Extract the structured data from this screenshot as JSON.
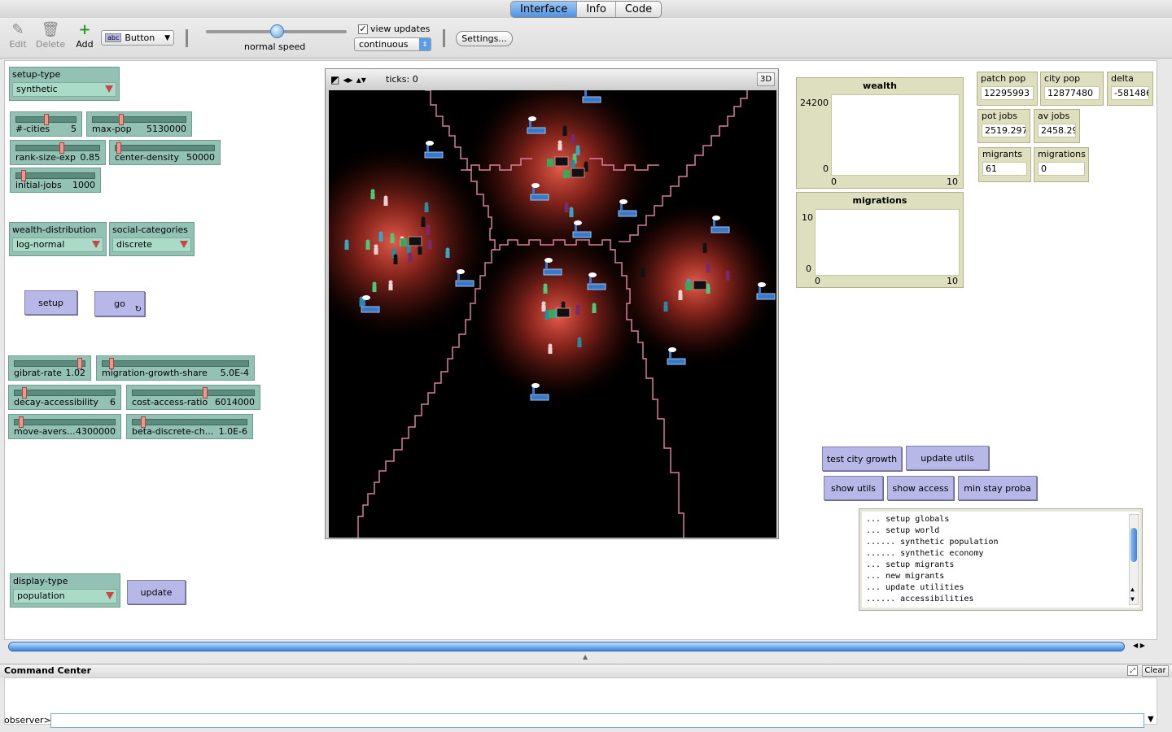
{
  "tabs": [
    "Interface",
    "Info",
    "Code"
  ],
  "toolbar": {
    "edit": "Edit",
    "delete": "Delete",
    "add": "Add",
    "widget_type": "Button",
    "speed_label": "normal speed",
    "speed_level": 0.5,
    "view_updates_label": "view updates",
    "view_updates_checked": true,
    "update_mode": "continuous",
    "settings": "Settings..."
  },
  "choosers": {
    "setup_type": {
      "label": "setup-type",
      "value": "synthetic"
    },
    "wealth_distribution": {
      "label": "wealth-distribution",
      "value": "log-normal"
    },
    "social_categories": {
      "label": "social-categories",
      "value": "discrete"
    },
    "display_type": {
      "label": "display-type",
      "value": "population"
    }
  },
  "sliders": {
    "n_cities": {
      "label": "#-cities",
      "value": "5",
      "level": 0.5
    },
    "max_pop": {
      "label": "max-pop",
      "value": "5130000",
      "level": 0.3
    },
    "rank_size_exp": {
      "label": "rank-size-exp",
      "value": "0.85",
      "level": 0.55
    },
    "center_density": {
      "label": "center-density",
      "value": "50000",
      "level": 0.02
    },
    "initial_jobs": {
      "label": "initial-jobs",
      "value": "1000",
      "level": 0.08
    },
    "gibrat_rate": {
      "label": "gibrat-rate",
      "value": "1.02",
      "level": 0.95
    },
    "migration_growth_share": {
      "label": "migration-growth-share",
      "value": "5.0E-4",
      "level": 0.05
    },
    "decay_accessibility": {
      "label": "decay-accessibility",
      "value": "6",
      "level": 0.08
    },
    "cost_access_ratio": {
      "label": "cost-access-ratio",
      "value": "6014000",
      "level": 0.6
    },
    "move_aversion": {
      "label": "move-avers...",
      "value": "4300000",
      "level": 0.05
    },
    "beta_discrete": {
      "label": "beta-discrete-ch...",
      "value": "1.0E-6",
      "level": 0.08
    }
  },
  "buttons": {
    "setup": "setup",
    "go": "go",
    "update": "update",
    "test_city_growth": "test city growth",
    "update_utils": "update utils",
    "show_utils": "show utils",
    "show_access": "show access",
    "min_stay_proba": "min stay proba"
  },
  "view": {
    "ticks": "ticks: 0",
    "three_d": "3D"
  },
  "plots": {
    "wealth": {
      "title": "wealth",
      "ymax": "24200",
      "ymin": "0",
      "xmin": "0",
      "xmax": "10"
    },
    "migrations": {
      "title": "migrations",
      "ymax": "10",
      "ymin": "0",
      "xmin": "0",
      "xmax": "10"
    }
  },
  "monitors": {
    "patch_pop": {
      "label": "patch pop",
      "value": "12295993"
    },
    "city_pop": {
      "label": "city pop",
      "value": "12877480"
    },
    "delta": {
      "label": "delta",
      "value": "-581486"
    },
    "pot_jobs": {
      "label": "pot jobs",
      "value": "2519.297"
    },
    "av_jobs": {
      "label": "av jobs",
      "value": "2458.29"
    },
    "migrants": {
      "label": "migrants",
      "value": "61"
    },
    "migrations": {
      "label": "migrations",
      "value": "0"
    }
  },
  "output_lines": [
    "... setup globals",
    "... setup world",
    "...... synthetic population",
    "...... synthetic economy",
    "... setup migrants",
    "... new migrants",
    "... update utilities",
    "...... accessibilities"
  ],
  "command_center": {
    "title": "Command Center",
    "clear": "Clear",
    "prompt": "observer>"
  },
  "colors": {
    "button": "#b8b8e8",
    "slider": "#93c2b4",
    "monitor": "#dedfbe",
    "knob": "#e89a8f",
    "border_line": "#d87f9a",
    "tab_active": "#5a9de6"
  }
}
